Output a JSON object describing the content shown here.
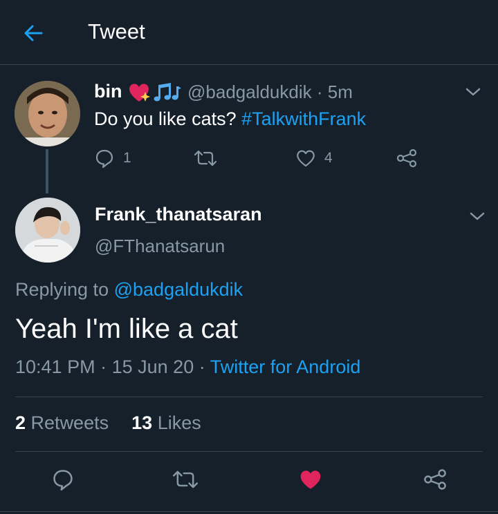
{
  "header": {
    "title": "Tweet"
  },
  "parent_tweet": {
    "name": "bin",
    "emojis": [
      "sparkling-heart-emoji",
      "musical-notes-emoji"
    ],
    "handle": "@badgaldukdik · 5m",
    "text": "Do you like cats?",
    "hashtag": "#TalkwithFrank",
    "reply_count": "1",
    "like_count": "4"
  },
  "main_tweet": {
    "name": "Frank_thanatsaran",
    "handle": "@FThanatsarun",
    "replying_prefix": "Replying to",
    "replying_handle": "@badgaldukdik",
    "text": "Yeah I'm like a cat",
    "time": "10:41 PM",
    "date": "15 Jun 20",
    "client": "Twitter for Android",
    "retweets": "2",
    "retweets_label": "Retweets",
    "likes": "13",
    "likes_label": "Likes",
    "liked": true
  },
  "colors": {
    "background": "#15202b",
    "accent": "#1da1f2",
    "muted": "#8899a6",
    "like": "#e0245e",
    "divider": "#38444d"
  }
}
